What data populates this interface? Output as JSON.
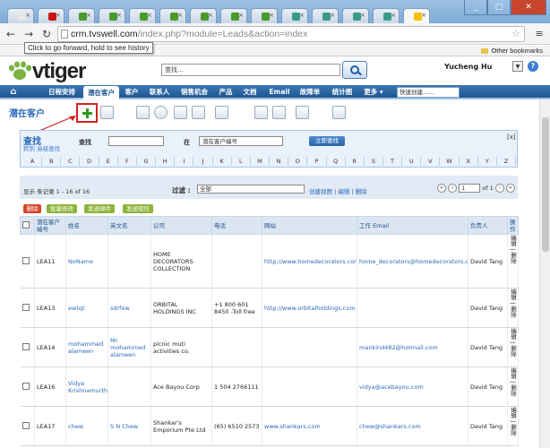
{
  "browser": {
    "tabs": [
      {
        "color": "#e8e8e8"
      },
      {
        "color": "#c81414"
      },
      {
        "color": "#4a9a2a"
      },
      {
        "color": "#4a9a2a"
      },
      {
        "color": "#4a9a2a"
      },
      {
        "color": "#4a9a2a"
      },
      {
        "color": "#4a9a2a"
      },
      {
        "color": "#4a9a2a"
      },
      {
        "color": "#4a9a2a"
      },
      {
        "color": "#3a9a8a"
      },
      {
        "color": "#3a9a8a"
      },
      {
        "color": "#3a9a8a"
      },
      {
        "color": "#3a9a8a"
      },
      {
        "color": "#f5c000"
      }
    ],
    "url_host": "crm.tvswell.com",
    "url_path": "/index.php?module=Leads&action=index",
    "tooltip": "Click to go forward, hold to see history",
    "other_bookmarks": "Other bookmarks"
  },
  "header": {
    "logo_text": "vtiger",
    "search_placeholder": "查找...",
    "user_name": "Yucheng Hu",
    "help_label": "?"
  },
  "nav": {
    "home_icon": "⌂",
    "items": [
      "日程安排",
      "潜在客户",
      "客户",
      "联系人",
      "销售机会",
      "产品",
      "文档",
      "Email",
      "故障单",
      "统计图",
      "更多 ▾"
    ],
    "quick_create": "快速创建......"
  },
  "page": {
    "title": "潜在客户"
  },
  "search_panel": {
    "title": "查找",
    "sub_links": "转到 高级查找",
    "for_label": "查找",
    "in_label": "在",
    "field_select": "潜在客户编号",
    "submit": "立即查找",
    "close": "[x]",
    "letters": [
      "A",
      "B",
      "C",
      "D",
      "E",
      "F",
      "G",
      "H",
      "I",
      "J",
      "K",
      "L",
      "M",
      "N",
      "O",
      "P",
      "Q",
      "R",
      "S",
      "T",
      "U",
      "V",
      "W",
      "X",
      "Y",
      "Z"
    ]
  },
  "list": {
    "count_text": "显示 条记录 1 - 16 of 16",
    "filter_label": "过滤 :",
    "filter_value": "全部",
    "filter_links": "创建视图 | 编辑 | 删除",
    "page_value": "1",
    "page_of": "of 1",
    "actions": [
      "删除",
      "批量修改",
      "发送邮件",
      "发送短信"
    ],
    "action_colors": [
      "#d9432b",
      "#8cb43a",
      "#8cb43a",
      "#8cb43a"
    ],
    "columns": [
      "",
      "潜在客户编号",
      "姓名",
      "英文名",
      "公司",
      "电话",
      "网站",
      "工作 Email",
      "负责人",
      "操作"
    ],
    "rows": [
      {
        "id": "LEA11",
        "name": "NoName",
        "en": "",
        "company": "HOME DECORATORS COLLECTION",
        "phone": "",
        "website": "http://www.homedecorators.com/",
        "email": "home_decorators@homedecorators.com",
        "owner": "David Tang"
      },
      {
        "id": "LEA13",
        "name": "ewtqt",
        "en": "sdrfew",
        "company": "ORBITAL HOLDINGS INC",
        "phone": "+1 800 601 8450 -Toll free",
        "website": "http://www.orbitalholdings.com",
        "email": "",
        "owner": "David Tang"
      },
      {
        "id": "LEA14",
        "name": "mohammed alameen",
        "en": "Mr. mohammed alameen",
        "company": "picnic muti activities co.",
        "phone": "",
        "website": "",
        "email": "mankind482@hotmail.com",
        "owner": "David Tang"
      },
      {
        "id": "LEA16",
        "name": "Vidya Krishnamurthy",
        "en": "",
        "company": "Ace Bayou Corp",
        "phone": "1 504 2766111",
        "website": "",
        "email": "vidya@acebayou.com",
        "owner": "David Tang"
      },
      {
        "id": "LEA17",
        "name": "chew",
        "en": "S N Chew",
        "company": "Shankar's Emporium Pte Ltd",
        "phone": "(65) 6510 2573",
        "website": "www.shankars.com",
        "email": "chew@shankars.com",
        "owner": "David Tang"
      }
    ],
    "row_ops": "编辑 | 删除"
  }
}
